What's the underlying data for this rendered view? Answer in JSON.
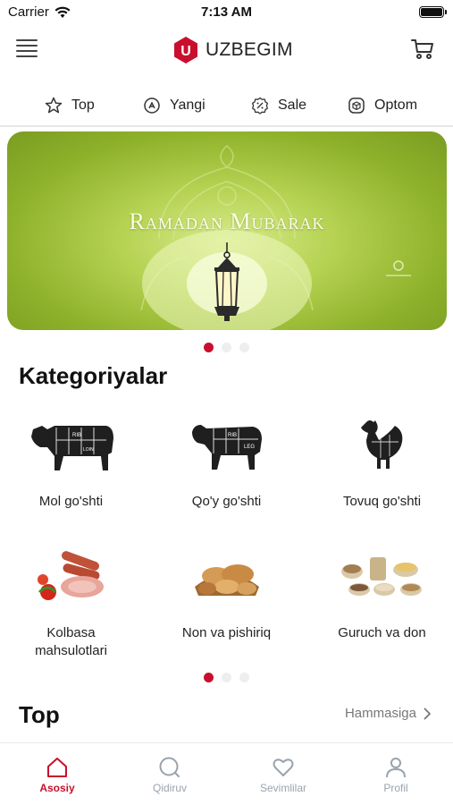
{
  "status_bar": {
    "carrier": "Carrier",
    "time": "7:13 AM"
  },
  "header": {
    "logo_text": "UZBEGIM",
    "logo_letter": "U",
    "brand_color": "#c8102e",
    "menu_icon": "hamburger-menu-icon",
    "cart_icon": "cart-icon"
  },
  "quick_tabs": [
    {
      "label": "Top",
      "icon": "star-icon"
    },
    {
      "label": "Yangi",
      "icon": "new-badge-icon"
    },
    {
      "label": "Sale",
      "icon": "percent-badge-icon"
    },
    {
      "label": "Optom",
      "icon": "box-icon"
    }
  ],
  "banner": {
    "text": "Ramadan Mubarak",
    "background": "#9bbd2d",
    "slide_count": 3,
    "active_slide": 1
  },
  "categories_section": {
    "title": "Kategoriyalar",
    "items": [
      {
        "label": "Mol go'shti",
        "icon": "cow-icon"
      },
      {
        "label": "Qo'y go'shti",
        "icon": "sheep-icon"
      },
      {
        "label": "Tovuq go'shti",
        "icon": "chicken-icon"
      },
      {
        "label_line1": "Kolbasa",
        "label_line2": "mahsulotlari",
        "icon": "sausage-icon"
      },
      {
        "label": "Non va pishiriq",
        "icon": "bread-icon"
      },
      {
        "label": "Guruch va don",
        "icon": "grain-icon"
      }
    ],
    "page_count": 3,
    "active_page": 1
  },
  "top_section": {
    "title": "Top",
    "see_all": "Hammasiga"
  },
  "tab_bar": [
    {
      "label": "Asosiy",
      "icon": "home-icon",
      "active": true
    },
    {
      "label": "Qidiruv",
      "icon": "search-icon",
      "active": false
    },
    {
      "label": "Sevimlilar",
      "icon": "heart-icon",
      "active": false
    },
    {
      "label": "Profil",
      "icon": "user-icon",
      "active": false
    }
  ],
  "colors": {
    "accent": "#c8102e",
    "inactive": "#9aa3ad"
  }
}
